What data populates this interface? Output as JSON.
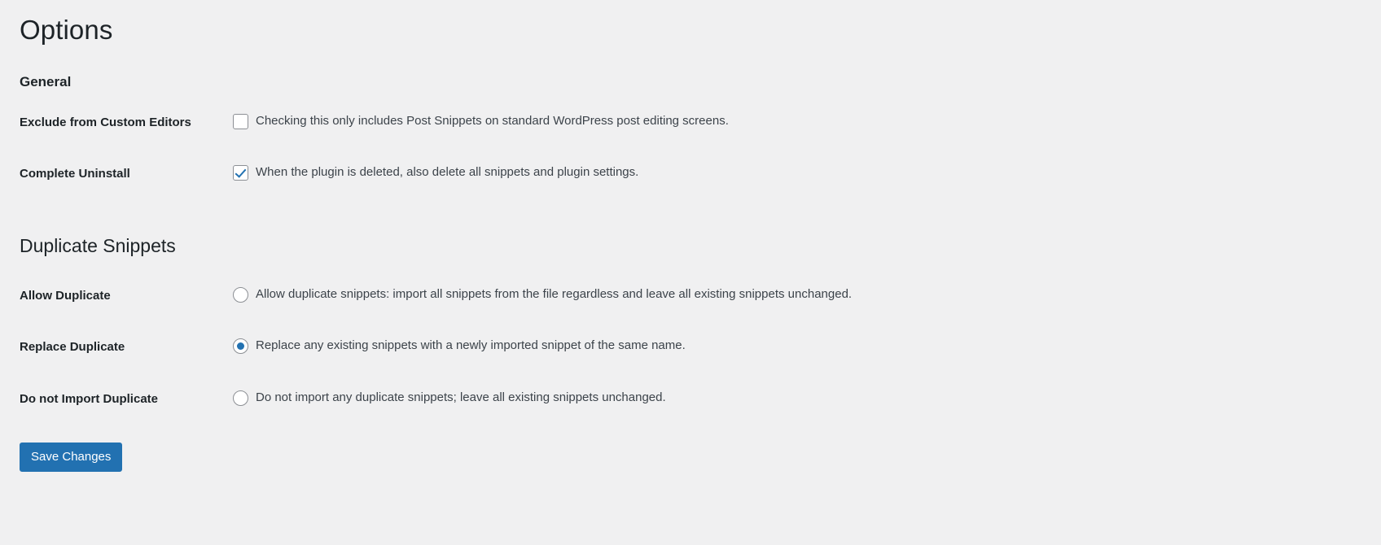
{
  "page": {
    "title": "Options"
  },
  "sections": [
    {
      "id": "general",
      "heading": "General",
      "heading_size": "small",
      "rows": [
        {
          "label": "Exclude from Custom Editors",
          "control": "checkbox",
          "checked": false,
          "description": "Checking this only includes Post Snippets on standard WordPress post editing screens."
        },
        {
          "label": "Complete Uninstall",
          "control": "checkbox",
          "checked": true,
          "description": "When the plugin is deleted, also delete all snippets and plugin settings."
        }
      ]
    },
    {
      "id": "duplicate-snippets",
      "heading": "Duplicate Snippets",
      "heading_size": "large",
      "rows": [
        {
          "label": "Allow Duplicate",
          "control": "radio",
          "checked": false,
          "description": "Allow duplicate snippets: import all snippets from the file regardless and leave all existing snippets unchanged."
        },
        {
          "label": "Replace Duplicate",
          "control": "radio",
          "checked": true,
          "description": "Replace any existing snippets with a newly imported snippet of the same name."
        },
        {
          "label": "Do not Import Duplicate",
          "control": "radio",
          "checked": false,
          "description": "Do not import any duplicate snippets; leave all existing snippets unchanged."
        }
      ]
    }
  ],
  "submit": {
    "save_label": "Save Changes"
  },
  "colors": {
    "page_background": "#f0f0f1",
    "accent": "#2271b1",
    "heading_text": "#1d2327",
    "body_text": "#3c434a",
    "control_border": "#8c8f94"
  }
}
